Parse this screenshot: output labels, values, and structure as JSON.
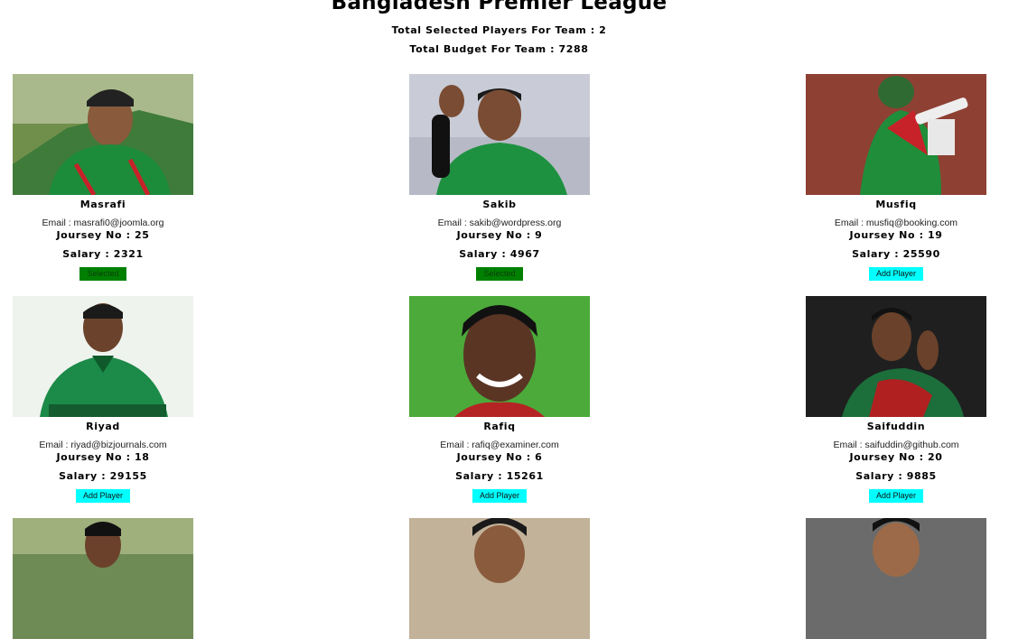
{
  "header": {
    "title": "Bangladesh Premier League",
    "selected_label": "Total Selected Players For Team : 2",
    "budget_label": "Total Budget For Team : 7288"
  },
  "players": [
    {
      "name": "Masrafi",
      "email": "Email : masrafi0@joomla.org",
      "journey": "Joursey No : 25",
      "salary": "Salary : 2321",
      "button": "Selected",
      "state": "selected"
    },
    {
      "name": "Sakib",
      "email": "Email : sakib@wordpress.org",
      "journey": "Joursey No : 9",
      "salary": "Salary : 4967",
      "button": "Selected",
      "state": "selected"
    },
    {
      "name": "Musfiq",
      "email": "Email : musfiq@booking.com",
      "journey": "Joursey No : 19",
      "salary": "Salary : 25590",
      "button": "Add Player",
      "state": "add"
    },
    {
      "name": "Riyad",
      "email": "Email : riyad@bizjournals.com",
      "journey": "Joursey No : 18",
      "salary": "Salary : 29155",
      "button": "Add Player",
      "state": "add"
    },
    {
      "name": "Rafiq",
      "email": "Email : rafiq@examiner.com",
      "journey": "Joursey No : 6",
      "salary": "Salary : 15261",
      "button": "Add Player",
      "state": "add"
    },
    {
      "name": "Saifuddin",
      "email": "Email : saifuddin@github.com",
      "journey": "Joursey No : 20",
      "salary": "Salary : 9885",
      "button": "Add Player",
      "state": "add"
    }
  ],
  "colors": {
    "selected_button": "#008000",
    "add_button": "#00ffff"
  }
}
